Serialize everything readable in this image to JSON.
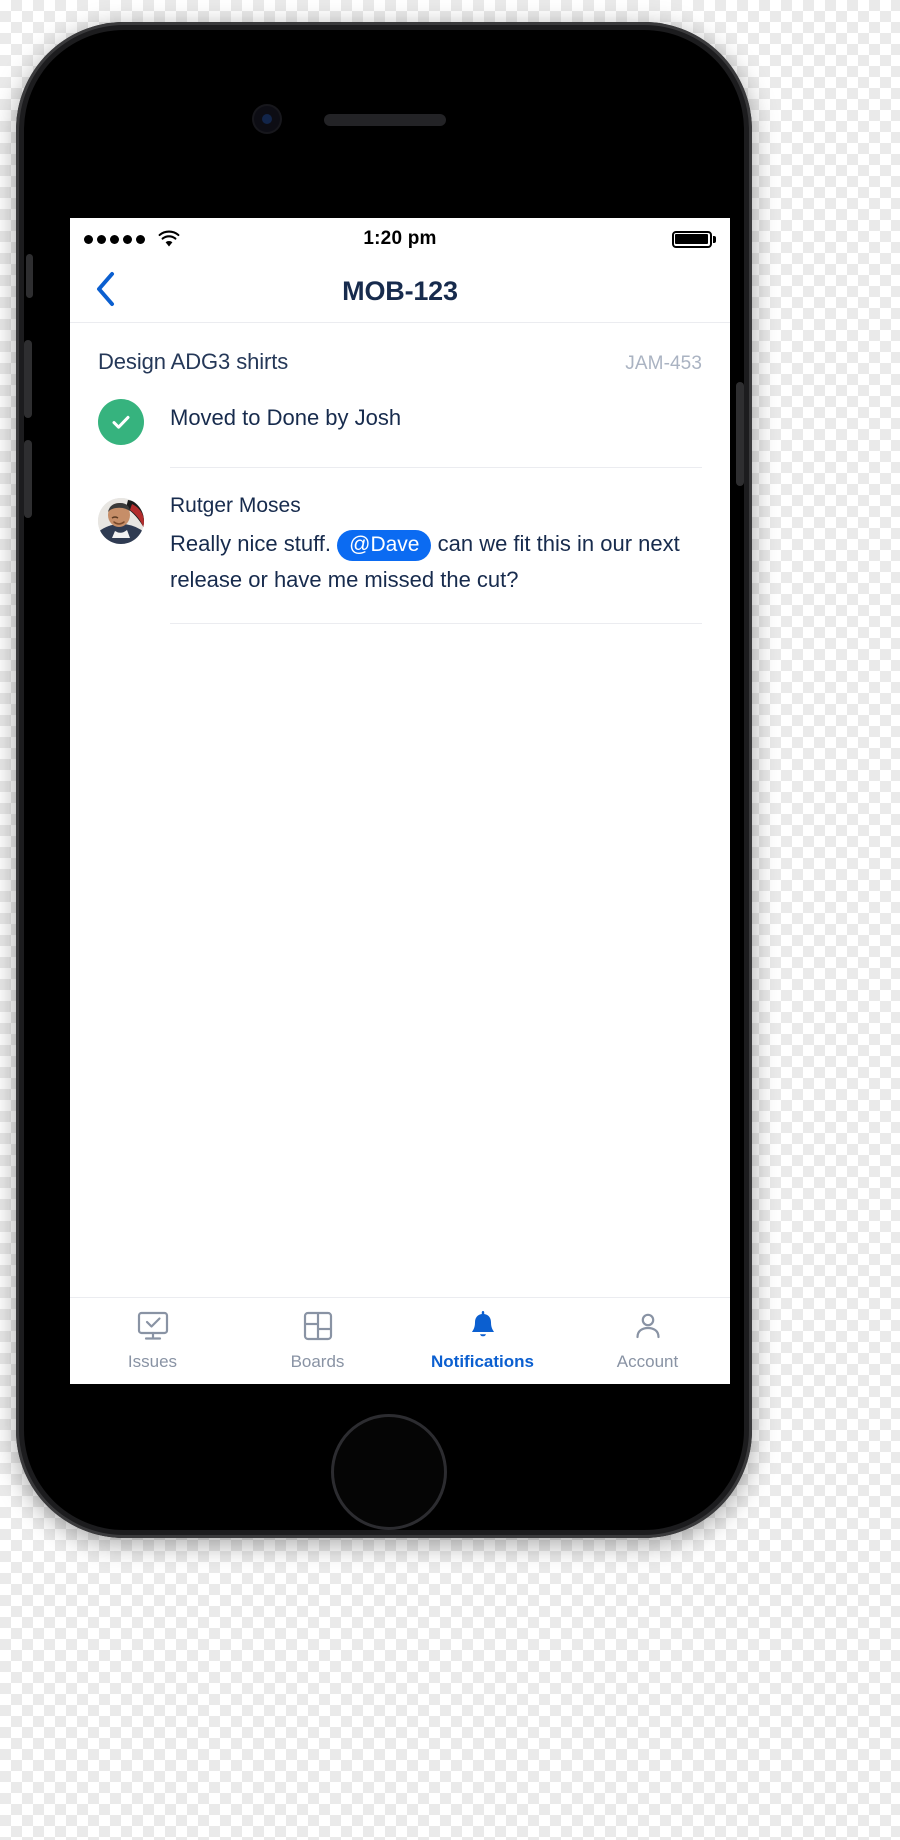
{
  "status_bar": {
    "signal_dots": 5,
    "wifi_icon": "wifi-icon",
    "time": "1:20 pm",
    "battery_icon": "battery-full-icon",
    "battery_level": 100
  },
  "nav": {
    "back_icon": "chevron-left-icon",
    "title": "MOB-123"
  },
  "issue": {
    "title": "Design ADG3 shirts",
    "key": "JAM-453"
  },
  "activity": {
    "status_icon": "check-circle-icon",
    "status_color": "#36b37e",
    "text": "Moved to Done by Josh"
  },
  "comment": {
    "avatar_icon": "user-avatar-photo",
    "author": "Rutger Moses",
    "text_before": "Really nice stuff.",
    "mention": "@Dave",
    "mention_color": "#0b6bf2",
    "text_after": "can we fit this in our next release or have me missed the cut?"
  },
  "tabbar": {
    "active_color": "#0b5fd0",
    "inactive_color": "#8993a4",
    "tabs": [
      {
        "label": "Issues",
        "icon": "issues-monitor-icon",
        "active": false
      },
      {
        "label": "Boards",
        "icon": "boards-grid-icon",
        "active": false
      },
      {
        "label": "Notifications",
        "icon": "bell-icon",
        "active": true
      },
      {
        "label": "Account",
        "icon": "person-icon",
        "active": false
      }
    ]
  }
}
